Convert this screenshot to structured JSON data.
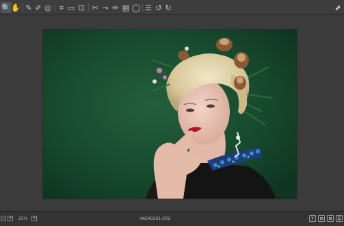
{
  "toolbar": {
    "tools": [
      {
        "name": "zoom-icon",
        "glyph": "🔍"
      },
      {
        "name": "hand-icon",
        "glyph": "✋"
      },
      {
        "name": "white-balance-icon",
        "glyph": "✎"
      },
      {
        "name": "color-sampler-icon",
        "glyph": "✐"
      },
      {
        "name": "targeted-adjustment-icon",
        "glyph": "◎"
      },
      {
        "name": "crop-icon",
        "glyph": "⌗"
      },
      {
        "name": "straighten-icon",
        "glyph": "▭"
      },
      {
        "name": "transform-icon",
        "glyph": "⊡"
      },
      {
        "name": "spot-removal-icon",
        "glyph": "✂"
      },
      {
        "name": "red-eye-icon",
        "glyph": "⊸"
      },
      {
        "name": "adjustment-brush-icon",
        "glyph": "✏"
      },
      {
        "name": "graduated-filter-icon",
        "glyph": "▤"
      },
      {
        "name": "radial-filter-icon",
        "glyph": "◯"
      },
      {
        "name": "preferences-icon",
        "glyph": "☰"
      },
      {
        "name": "rotate-left-icon",
        "glyph": "↺"
      },
      {
        "name": "rotate-right-icon",
        "glyph": "↻"
      }
    ],
    "fullscreen_glyph": "⬈"
  },
  "status": {
    "zoom_label": "25%",
    "filename": "4A5A0291.CR2",
    "view_buttons": [
      "Y",
      "⊟",
      "⊞",
      "☰"
    ]
  },
  "colors": {
    "background": "#3a3a3a",
    "photo_backdrop": "#17472c"
  }
}
